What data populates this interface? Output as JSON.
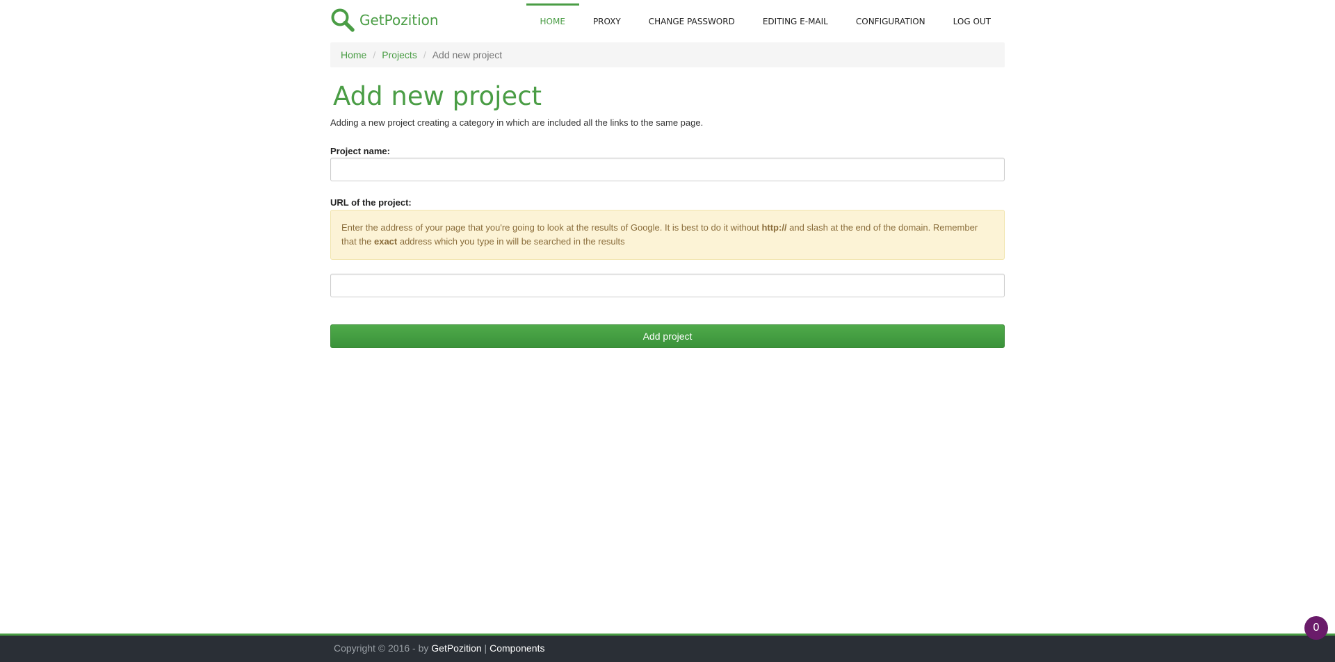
{
  "brand": {
    "name": "GetPozition",
    "icon": "magnifier-icon",
    "color": "#4a9d45"
  },
  "nav": {
    "items": [
      {
        "label": "HOME",
        "active": true
      },
      {
        "label": "PROXY"
      },
      {
        "label": "CHANGE PASSWORD"
      },
      {
        "label": "EDITING E-MAIL"
      },
      {
        "label": "CONFIGURATION"
      },
      {
        "label": "LOG OUT"
      }
    ]
  },
  "breadcrumb": {
    "home": "Home",
    "projects": "Projects",
    "current": "Add new project",
    "separator": "/"
  },
  "page": {
    "title": "Add new project",
    "description": "Adding a new project creating a category in which are included all the links to the same page."
  },
  "form": {
    "project_name_label": "Project name:",
    "project_name_value": "",
    "url_label": "URL of the project:",
    "url_value": "",
    "alert": {
      "text_1": "Enter the address of your page that you're going to look at the results of Google. It is best to do it without ",
      "bold_1": "http://",
      "text_2": " and slash at the end of the domain. Remember that the ",
      "bold_2": "exact",
      "text_3": " address which you type in will be searched in the results"
    },
    "submit_label": "Add project"
  },
  "footer": {
    "copyright": "Copyright © 2016 - by ",
    "brand_link": "GetPozition",
    "divider": " | ",
    "components_link": "Components"
  },
  "chat_badge": {
    "count": "0",
    "color": "#6a1b6a"
  }
}
